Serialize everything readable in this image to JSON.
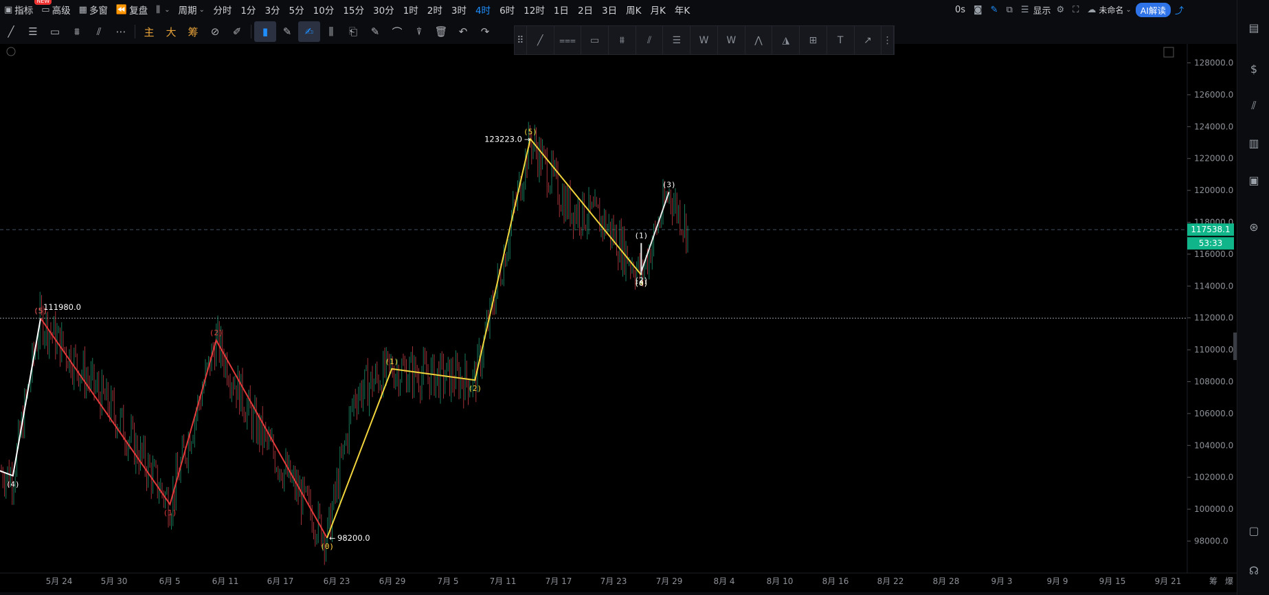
{
  "top": {
    "items": [
      {
        "icon": "indicator-icon",
        "ic": "▣",
        "label": "指标"
      },
      {
        "icon": "advanced-icon",
        "ic": "▭",
        "label": "高级",
        "badge": "NEW"
      },
      {
        "icon": "multiwindow-icon",
        "ic": "▦",
        "label": "多窗"
      },
      {
        "icon": "replay-icon",
        "ic": "⏪",
        "label": "复盘"
      },
      {
        "icon": "candle-type-icon",
        "ic": "⫼",
        "label": "",
        "chev": true
      },
      {
        "icon": "",
        "ic": "",
        "label": "周期",
        "chev": true
      }
    ],
    "periods": [
      "分时",
      "1分",
      "3分",
      "5分",
      "10分",
      "15分",
      "30分",
      "1时",
      "2时",
      "3时",
      "4时",
      "6时",
      "12时",
      "1日",
      "2日",
      "3日",
      "周K",
      "月K",
      "年K"
    ],
    "active_period": "4时",
    "countdown": "0s",
    "display_label": "显示",
    "cloud_label": "未命名",
    "ai_label": "AI解读"
  },
  "toolbar2": {
    "items": [
      "主",
      "大",
      "筹"
    ]
  },
  "chart_data": {
    "type": "candlestick",
    "x_ticks": [
      "5月 24",
      "5月 30",
      "6月 5",
      "6月 11",
      "6月 17",
      "6月 23",
      "6月 29",
      "7月 5",
      "7月 11",
      "7月 17",
      "7月 23",
      "7月 29",
      "8月 4",
      "8月 10",
      "8月 16",
      "8月 22",
      "8月 28",
      "9月 3",
      "9月 9",
      "9月 15",
      "9月 21",
      "筹",
      "爆"
    ],
    "y_ticks": [
      "128000.0",
      "126000.0",
      "124000.0",
      "122000.0",
      "120000.0",
      "118000.0",
      "116000.0",
      "114000.0",
      "112000.0",
      "110000.0",
      "108000.0",
      "106000.0",
      "104000.0",
      "102000.0",
      "100000.0",
      "98000.0"
    ],
    "ylim": [
      97000,
      129200
    ],
    "last_price": "117538.1",
    "countdown": "53:33",
    "hline": 111980,
    "price_labels": [
      {
        "text": "111980.0",
        "value": 111980
      },
      {
        "text": "123223.0",
        "value": 123223
      },
      {
        "text": "98200.0",
        "value": 98200
      }
    ],
    "white_wave": [
      {
        "date": "5/14",
        "p": 103200,
        "label": ""
      },
      {
        "date": "5/19",
        "p": 102100,
        "label": "(4)"
      },
      {
        "date": "5/22",
        "p": 111980,
        "label": "(5)"
      }
    ],
    "red_wave": [
      {
        "date": "5/22",
        "p": 111980,
        "label": "(5)"
      },
      {
        "date": "6/5",
        "p": 100300,
        "label": "(1)"
      },
      {
        "date": "6/10",
        "p": 110600,
        "label": "(2)"
      },
      {
        "date": "6/22",
        "p": 98200,
        "label": "(0)"
      }
    ],
    "yellow_wave": [
      {
        "date": "6/22",
        "p": 98200,
        "label": "(0)"
      },
      {
        "date": "6/29",
        "p": 108800,
        "label": "(1)"
      },
      {
        "date": "7/8",
        "p": 108100,
        "label": "(2)"
      },
      {
        "date": "7/14",
        "p": 123223,
        "label": "(5)"
      },
      {
        "date": "7/26",
        "p": 114700,
        "label": "(4)"
      }
    ],
    "small_wave": [
      {
        "date": "7/26",
        "p": 114700,
        "label": "(0)"
      },
      {
        "date": "7/26",
        "p": 116700,
        "label": "(1)"
      },
      {
        "date": "7/26",
        "p": 114900,
        "label": "(2)"
      },
      {
        "date": "7/29",
        "p": 119900,
        "label": "(3)"
      }
    ]
  }
}
